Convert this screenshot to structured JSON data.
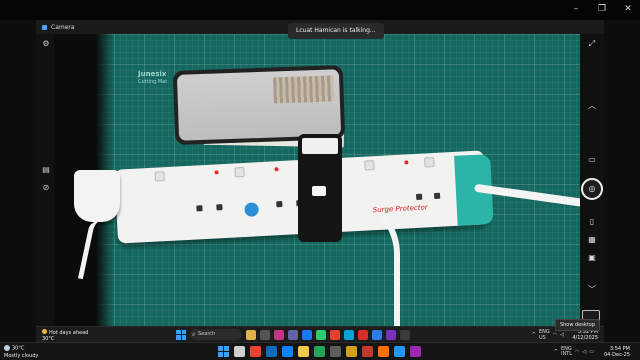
{
  "remote_window": {
    "title": "Camera",
    "talking_banner": "Lcuat Hamican is talking..."
  },
  "mat": {
    "brand": "Junesix",
    "subtitle": "Cutting Mat"
  },
  "power_strip": {
    "label": "Surge Protector"
  },
  "camera_controls": {
    "left": [
      "settings-icon",
      "hdr-icon",
      "timer-icon"
    ],
    "right": [
      "fullscreen-icon",
      "chevron-up-icon",
      "video-mode-icon",
      "shutter-icon",
      "document-mode-icon",
      "barcode-icon",
      "photo-mode-icon",
      "chevron-down-icon",
      "gallery-icon"
    ]
  },
  "remote_taskbar": {
    "weather_title": "Hot days ahead",
    "weather_temp": "30°C",
    "search_placeholder": "Search",
    "lang_top": "ENG",
    "lang_bottom": "US",
    "time": "3:52 PM",
    "date": "4/12/2025",
    "tooltip": "Show desktop"
  },
  "host_taskbar": {
    "weather_temp": "30°C",
    "weather_desc": "Mostly cloudy",
    "lang_top": "ENG",
    "lang_bottom": "INTL",
    "time": "3:54 PM",
    "date": "04-Dec-25"
  },
  "colors": {
    "mat": "#14685f",
    "strip_accent": "#2bb5a8",
    "windows_blue": "#3aa0ff",
    "led_red": "#e52a2a"
  }
}
